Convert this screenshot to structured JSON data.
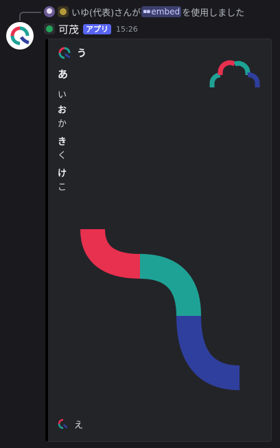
{
  "reply": {
    "user": "いゆ(代表)",
    "text_before": "さんが",
    "command": "embed",
    "text_after": "を使用しました"
  },
  "message": {
    "username": "可茂",
    "badge": "アプリ",
    "timestamp": "15:26"
  },
  "embed": {
    "border_color": "#000000",
    "author": "う",
    "title": "あ",
    "description": "い",
    "fields": [
      {
        "name": "お",
        "value": "か"
      },
      {
        "name": "き",
        "value": "く"
      },
      {
        "name": "け",
        "value": "こ"
      }
    ],
    "footer": "え"
  },
  "colors": {
    "logo_red": "#e8304f",
    "logo_teal": "#1fa296",
    "logo_blue": "#2f3f9e",
    "app_badge": "#5865f2",
    "status_online": "#23a55a"
  },
  "icons": {
    "command": "app-command-icon",
    "logo": "wave-logo-icon"
  }
}
